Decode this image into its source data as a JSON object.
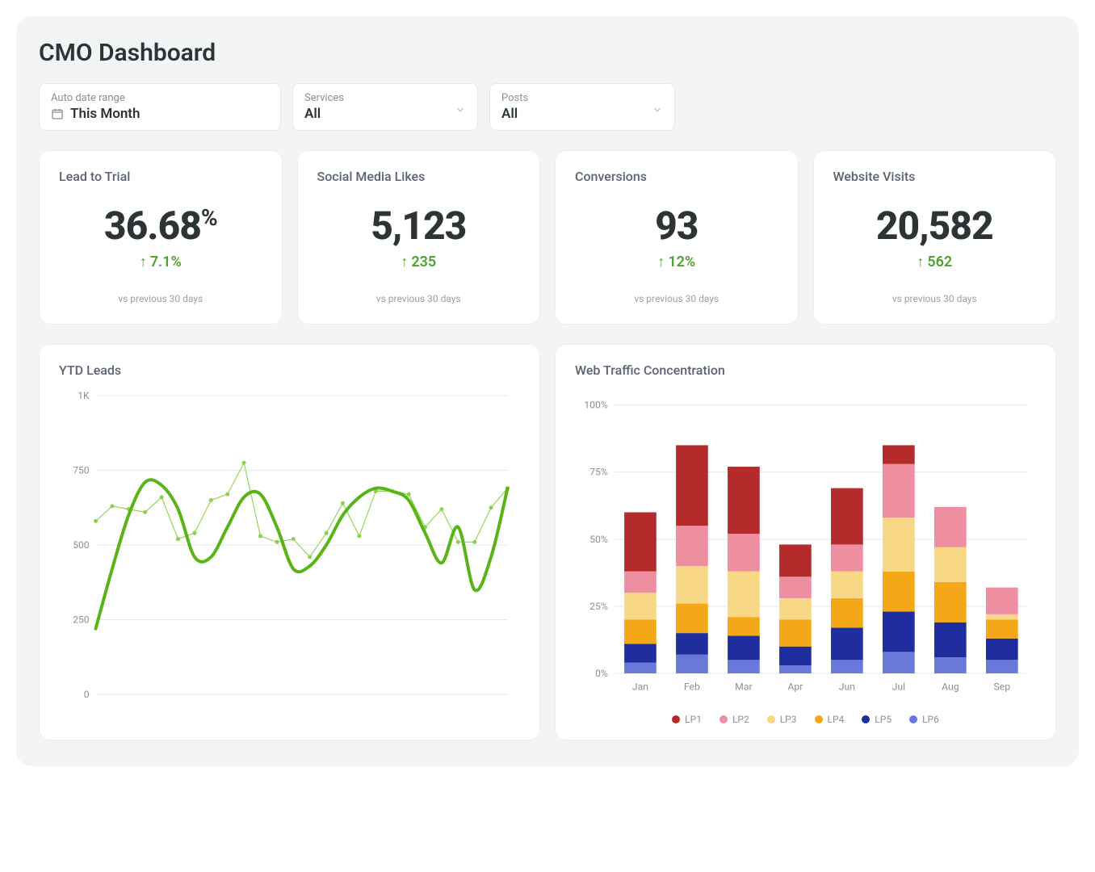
{
  "title": "CMO Dashboard",
  "filters": {
    "date": {
      "label": "Auto date range",
      "value": "This Month"
    },
    "services": {
      "label": "Services",
      "value": "All"
    },
    "posts": {
      "label": "Posts",
      "value": "All"
    }
  },
  "kpis": [
    {
      "title": "Lead to Trial",
      "value": "36.68",
      "unit": "%",
      "delta": "7.1%",
      "sub": "vs previous 30 days"
    },
    {
      "title": "Social Media Likes",
      "value": "5,123",
      "unit": "",
      "delta": "235",
      "sub": "vs previous 30 days"
    },
    {
      "title": "Conversions",
      "value": "93",
      "unit": "",
      "delta": "12%",
      "sub": "vs previous 30 days"
    },
    {
      "title": "Website Visits",
      "value": "20,582",
      "unit": "",
      "delta": "562",
      "sub": "vs previous 30 days"
    }
  ],
  "charts": {
    "ytd": {
      "title": "YTD Leads"
    },
    "wtc": {
      "title": "Web Traffic Concentration"
    }
  },
  "chart_data": [
    {
      "id": "ytd_leads",
      "type": "line",
      "title": "YTD Leads",
      "ylabel": "",
      "xlabel": "",
      "ylim": [
        0,
        1000
      ],
      "yticks": [
        0,
        250,
        500,
        750,
        1000
      ],
      "ytick_labels": [
        "0",
        "250",
        "500",
        "750",
        "1K"
      ],
      "series": [
        {
          "name": "raw",
          "color": "#8bd24a",
          "values": [
            580,
            630,
            620,
            610,
            660,
            520,
            540,
            650,
            670,
            775,
            530,
            510,
            520,
            460,
            540,
            640,
            530,
            680,
            680,
            670,
            560,
            620,
            510,
            510,
            625,
            690
          ]
        },
        {
          "name": "smoothed",
          "color": "#58b417",
          "values": [
            220,
            420,
            600,
            710,
            700,
            620,
            460,
            460,
            560,
            660,
            670,
            560,
            420,
            430,
            500,
            600,
            660,
            690,
            680,
            650,
            540,
            440,
            560,
            350,
            460,
            690
          ]
        }
      ]
    },
    {
      "id": "web_traffic_concentration",
      "type": "bar",
      "stacked": true,
      "title": "Web Traffic Concentration",
      "ylabel": "",
      "xlabel": "",
      "ylim": [
        0,
        100
      ],
      "yticks": [
        0,
        25,
        50,
        75,
        100
      ],
      "ytick_labels": [
        "0%",
        "25%",
        "50%",
        "75%",
        "100%"
      ],
      "categories": [
        "Jan",
        "Feb",
        "Mar",
        "Apr",
        "Jun",
        "Jul",
        "Aug",
        "Sep"
      ],
      "series": [
        {
          "name": "LP6",
          "color": "#6a79d9",
          "values": [
            4,
            7,
            5,
            3,
            5,
            8,
            6,
            5
          ]
        },
        {
          "name": "LP5",
          "color": "#1f2e9e",
          "values": [
            7,
            8,
            9,
            7,
            12,
            15,
            13,
            8
          ]
        },
        {
          "name": "LP4",
          "color": "#f4a817",
          "values": [
            9,
            11,
            7,
            10,
            11,
            15,
            15,
            7
          ]
        },
        {
          "name": "LP3",
          "color": "#f8d887",
          "values": [
            10,
            14,
            17,
            8,
            10,
            20,
            13,
            2
          ]
        },
        {
          "name": "LP2",
          "color": "#ed8fa0",
          "values": [
            8,
            15,
            14,
            8,
            10,
            20,
            15,
            10
          ]
        },
        {
          "name": "LP1",
          "color": "#b52a2a",
          "values": [
            22,
            30,
            25,
            12,
            21,
            7,
            0,
            0
          ]
        }
      ],
      "legend_order": [
        "LP1",
        "LP2",
        "LP3",
        "LP4",
        "LP5",
        "LP6"
      ],
      "legend_colors": {
        "LP1": "#b52a2a",
        "LP2": "#ed8fa0",
        "LP3": "#f8d887",
        "LP4": "#f4a817",
        "LP5": "#1f2e9e",
        "LP6": "#6a79d9"
      }
    }
  ]
}
